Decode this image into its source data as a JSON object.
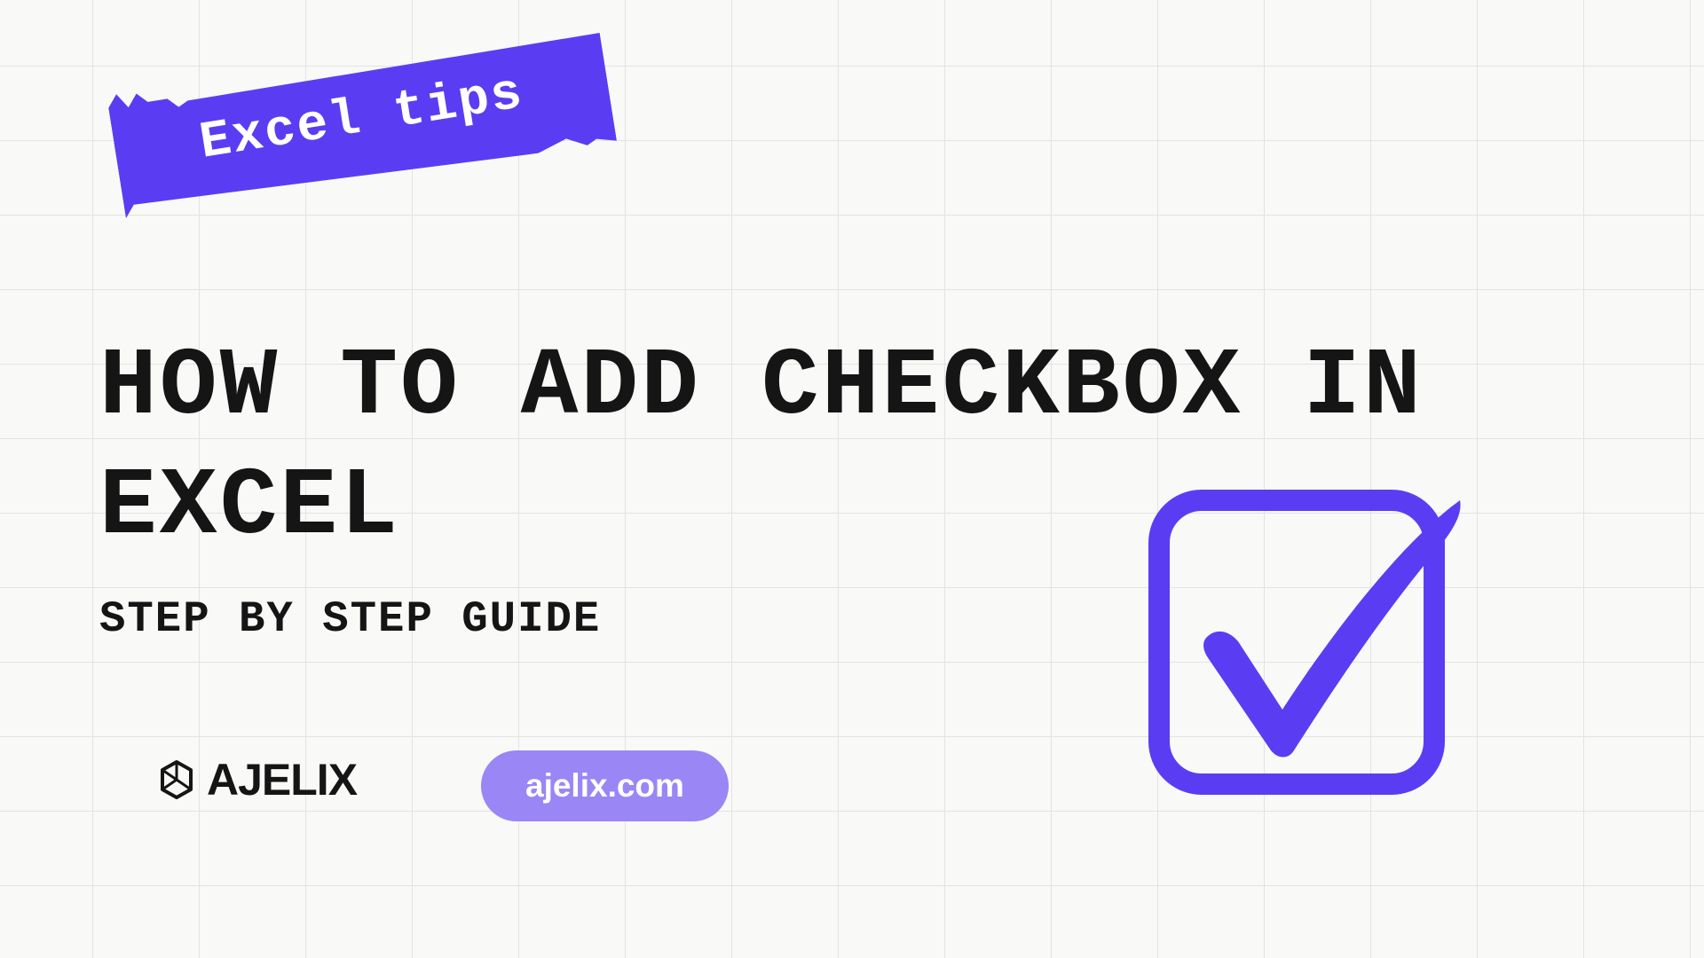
{
  "tape": {
    "label": "Excel tips"
  },
  "title": "HOW TO ADD CHECKBOX IN EXCEL",
  "subtitle": "STEP BY STEP GUIDE",
  "logo": {
    "text": "AJELIX"
  },
  "url": {
    "label": "ajelix.com"
  },
  "colors": {
    "accent": "#5a3df3",
    "pill": "#9b86f5"
  }
}
